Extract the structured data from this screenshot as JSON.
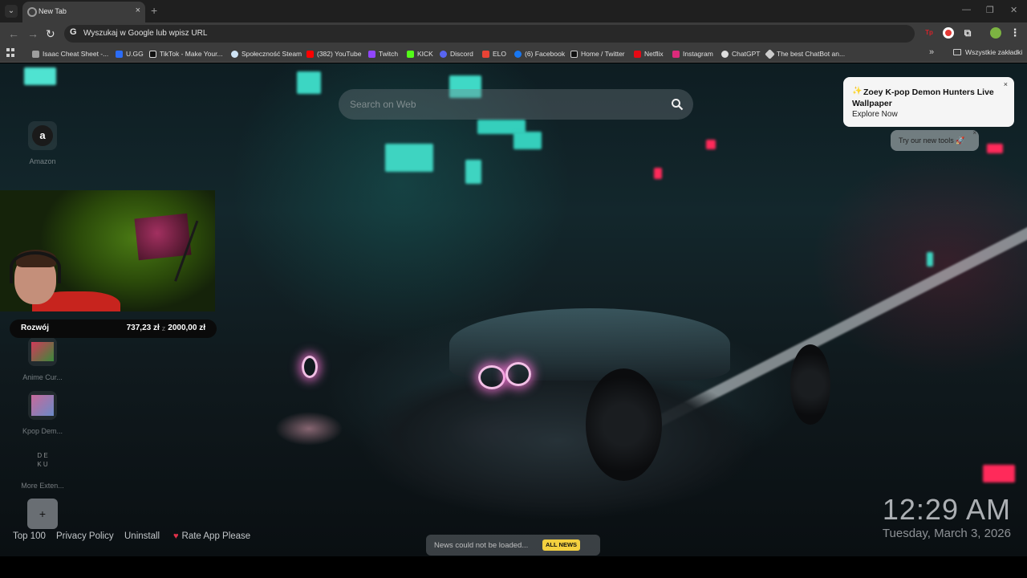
{
  "browser": {
    "tab": {
      "title": "New Tab",
      "close": "×"
    },
    "new_tab_symbol": "+",
    "window_controls": {
      "minimize": "—",
      "restore": "❐",
      "close": "✕"
    },
    "nav": {
      "back": "←",
      "forward": "→",
      "reload": "↻"
    },
    "omnibox": {
      "g_letter": "G",
      "placeholder": "Wyszukaj w Google lub wpisz URL"
    },
    "extensions": [
      {
        "name": "tp-extension-icon",
        "label": "Tp",
        "color": "#d4232a"
      },
      {
        "name": "red-circle-extension-icon",
        "label": "",
        "color": "#e53935"
      },
      {
        "name": "puzzle-extensions-icon",
        "label": "⧉",
        "color": "transparent"
      },
      {
        "name": "profile-avatar-icon",
        "label": "",
        "color": "#7cb342"
      },
      {
        "name": "menu-kebab-icon",
        "label": "⋮",
        "color": "transparent"
      }
    ]
  },
  "bookmarks": {
    "items": [
      {
        "label": "Isaac Cheat Sheet -...",
        "icon_color": "#9e9e9e"
      },
      {
        "label": "U.GG",
        "icon_color": "#2b6cf6"
      },
      {
        "label": "TikTok - Make Your...",
        "icon_color": "#111111"
      },
      {
        "label": "Społeczność Steam",
        "icon_color": "#1b2838"
      },
      {
        "label": "(382) YouTube",
        "icon_color": "#ff0000"
      },
      {
        "label": "Twitch",
        "icon_color": "#9146ff"
      },
      {
        "label": "KICK",
        "icon_color": "#53fc18"
      },
      {
        "label": "Discord",
        "icon_color": "#5865f2"
      },
      {
        "label": "ELO",
        "icon_color": "#ea4335"
      },
      {
        "label": "(6) Facebook",
        "icon_color": "#1877f2"
      },
      {
        "label": "Home / Twitter",
        "icon_color": "#111111"
      },
      {
        "label": "Netflix",
        "icon_color": "#e50914"
      },
      {
        "label": "Instagram",
        "icon_color": "#dd2a7b"
      },
      {
        "label": "ChatGPT",
        "icon_color": "#dddddd"
      },
      {
        "label": "The best ChatBot an...",
        "icon_color": "#cccccc"
      }
    ],
    "more": "»",
    "all_bookmarks": "Wszystkie zakładki"
  },
  "newtab": {
    "search": {
      "placeholder": "Search on Web"
    },
    "shortcuts": [
      {
        "label": "Amazon",
        "glyph": "a"
      },
      {
        "label": "Anime Cur...",
        "glyph": ""
      },
      {
        "label": "Kpop Dem...",
        "glyph": ""
      },
      {
        "label": "More Exten...",
        "glyph": "D E\nK U"
      }
    ],
    "add_shortcut": "+",
    "notification": {
      "icon": "✨",
      "title": "Zoey K-pop Demon Hunters Live Wallpaper",
      "link": "Explore Now",
      "close": "×"
    },
    "tools_pill": {
      "text": "Try our new tools 🚀",
      "close": "×"
    },
    "footer_links": [
      "Top 100",
      "Privacy Policy",
      "Uninstall",
      "Rate App Please"
    ],
    "news": {
      "text": "News could not be loaded...",
      "button": "ALL NEWS"
    },
    "clock": {
      "time": "12:29 AM",
      "date": "Tuesday, March 3, 2026"
    }
  },
  "stream_overlay": {
    "goal": {
      "label": "Rozwój",
      "current": "737,23 zł",
      "separator": "z",
      "target": "2000,00 zł",
      "progress_fraction": 0.369
    }
  },
  "colors": {
    "tabstrip": "#1f1f1f",
    "toolbar": "#3c3c3c",
    "accent_news": "#f4d03f",
    "heart": "#e0314a"
  }
}
